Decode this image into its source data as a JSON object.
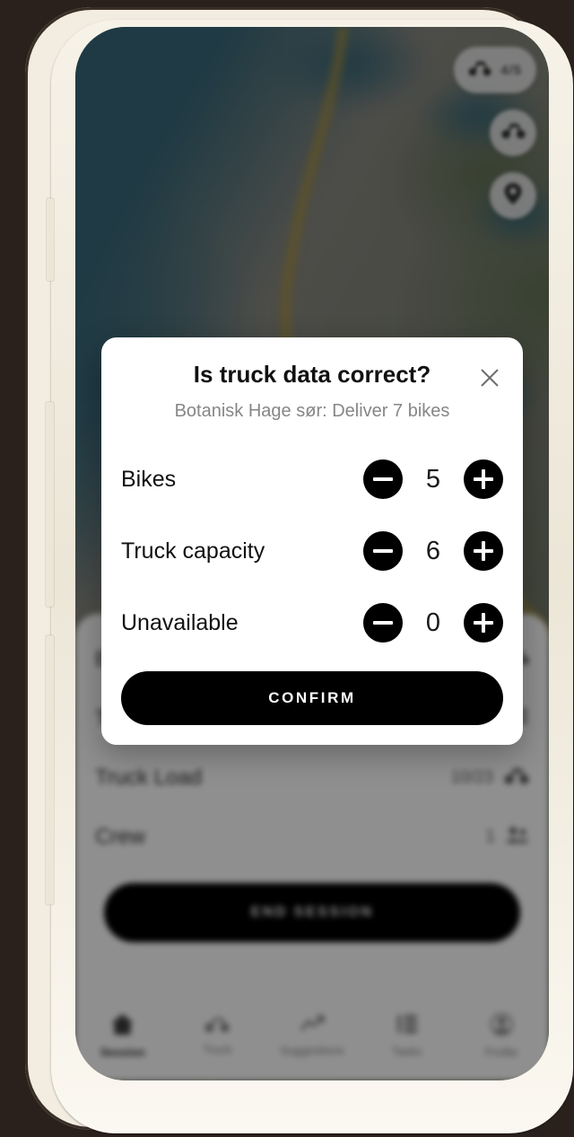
{
  "device": {
    "buttons": {
      "silent": "silent-switch",
      "volume_up": "volume-up",
      "volume_down": "volume-down",
      "power": "power"
    }
  },
  "map": {
    "controls": [
      {
        "id": "bike-count",
        "icon": "bike-icon",
        "value": "4/5"
      },
      {
        "id": "bike-filter",
        "icon": "bike-icon",
        "value": ""
      },
      {
        "id": "locate",
        "icon": "location-pin-icon",
        "value": ""
      }
    ]
  },
  "sheet": {
    "rows": [
      {
        "label": "Bikes",
        "value": "",
        "icon": "bike-icon"
      },
      {
        "label": "Tasks",
        "value": "",
        "icon": "tasks-icon"
      },
      {
        "label": "Truck Load",
        "value": "10/23",
        "icon": "bike-icon"
      },
      {
        "label": "Crew",
        "value": "1",
        "icon": "people-icon"
      }
    ],
    "end_session_label": "END SESSION"
  },
  "tabs": [
    {
      "label": "Session",
      "icon": "home-icon",
      "active": true
    },
    {
      "label": "Truck",
      "icon": "bike-icon",
      "active": false
    },
    {
      "label": "Suggestions",
      "icon": "trend-up-icon",
      "active": false
    },
    {
      "label": "Tasks",
      "icon": "tasks-icon",
      "active": false
    },
    {
      "label": "Profile",
      "icon": "person-badge-icon",
      "active": false
    }
  ],
  "dialog": {
    "title": "Is truck data correct?",
    "subtitle": "Botanisk Hage sør: Deliver 7 bikes",
    "close_icon": "close-icon",
    "steppers": [
      {
        "label": "Bikes",
        "value": "5",
        "decrement": "−",
        "increment": "+"
      },
      {
        "label": "Truck capacity",
        "value": "6",
        "decrement": "−",
        "increment": "+"
      },
      {
        "label": "Unavailable",
        "value": "0",
        "decrement": "−",
        "increment": "+"
      }
    ],
    "confirm_label": "CONFIRM"
  },
  "colors": {
    "background": "#2a211c",
    "bezel": "#f2ede0",
    "accent": "#000000",
    "water": "#3a7287",
    "land": "#8e9184",
    "road": "#c9a83f",
    "muted_text": "#868686"
  }
}
